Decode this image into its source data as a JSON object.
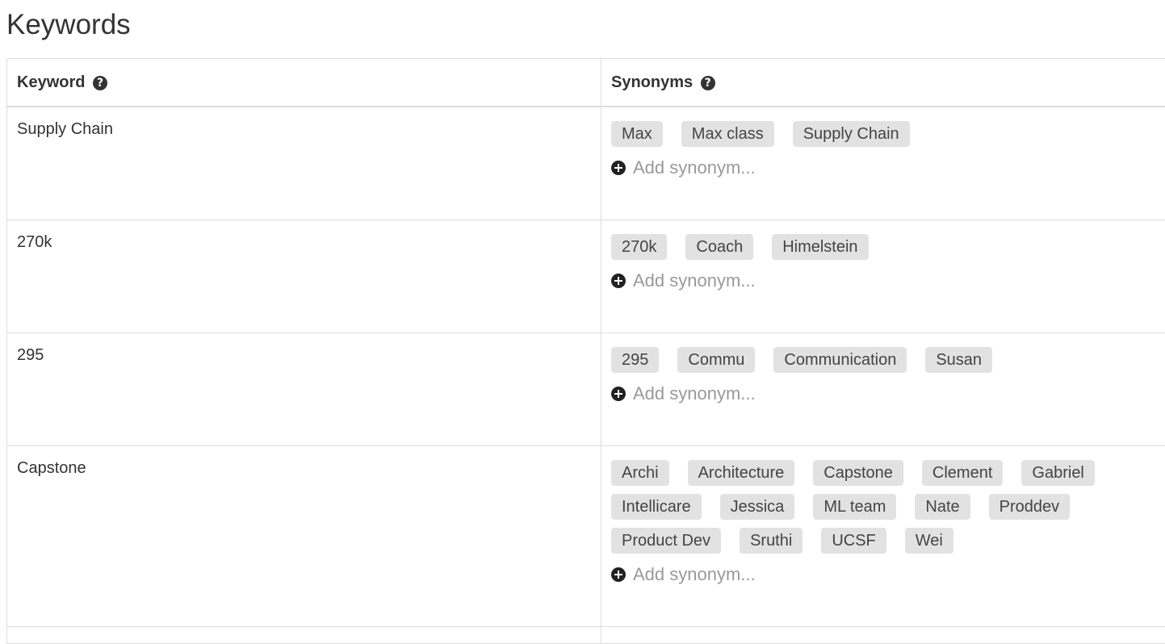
{
  "page": {
    "title": "Keywords"
  },
  "table": {
    "headers": {
      "keyword": "Keyword",
      "synonyms": "Synonyms"
    },
    "add_placeholder": "Add synonym...",
    "rows": [
      {
        "keyword": "Supply Chain",
        "synonyms": [
          "Max",
          "Max class",
          "Supply Chain"
        ]
      },
      {
        "keyword": "270k",
        "synonyms": [
          "270k",
          "Coach",
          "Himelstein"
        ]
      },
      {
        "keyword": "295",
        "synonyms": [
          "295",
          "Commu",
          "Communication",
          "Susan"
        ]
      },
      {
        "keyword": "Capstone",
        "synonyms": [
          "Archi",
          "Architecture",
          "Capstone",
          "Clement",
          "Gabriel",
          "Intellicare",
          "Jessica",
          "ML team",
          "Nate",
          "Proddev",
          "Product Dev",
          "Sruthi",
          "UCSF",
          "Wei"
        ]
      }
    ]
  },
  "icons": {
    "help": "question-circle-icon",
    "add": "plus-circle-icon"
  }
}
